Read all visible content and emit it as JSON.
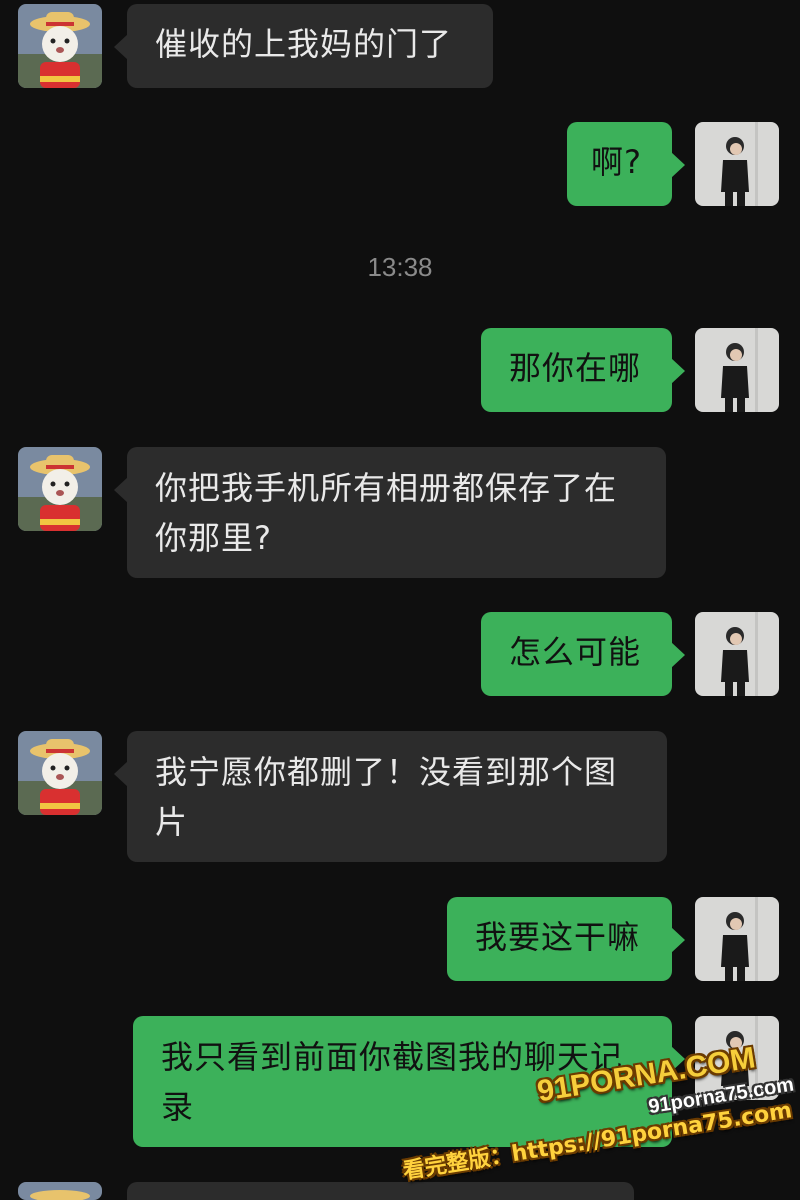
{
  "timestamp": "13:38",
  "messages": [
    {
      "side": "left",
      "text": "催收的上我妈的门了"
    },
    {
      "side": "right",
      "text": "啊?"
    },
    {
      "side": "right",
      "text": "那你在哪"
    },
    {
      "side": "left",
      "text": "你把我手机所有相册都保存了在你那里?"
    },
    {
      "side": "right",
      "text": "怎么可能"
    },
    {
      "side": "left",
      "text": "我宁愿你都删了！没看到那个图片"
    },
    {
      "side": "right",
      "text": "我要这干嘛"
    },
    {
      "side": "right",
      "text": "我只看到前面你截图我的聊天记录"
    }
  ],
  "watermark": {
    "brand": "91PORNA.COM",
    "url": "91porna75.com",
    "bottom": "看完整版：https://91porna75.com"
  },
  "colors": {
    "background": "#0f0f0f",
    "incoming_bubble": "#2c2c2c",
    "outgoing_bubble": "#3cb15a",
    "watermark": "#f6ce3b"
  },
  "icons": {
    "incoming_avatar": "cat-in-straw-hat-avatar",
    "outgoing_avatar": "person-in-black-suit-avatar"
  }
}
